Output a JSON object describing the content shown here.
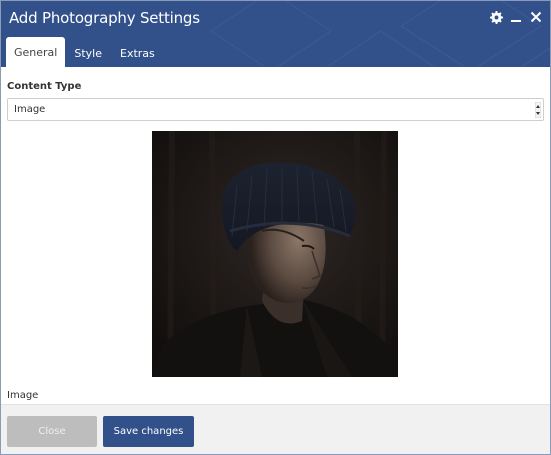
{
  "dialog": {
    "title": "Add Photography Settings",
    "window_icons": [
      "gear-icon",
      "minimize-icon",
      "close-icon"
    ]
  },
  "tabs": [
    {
      "label": "General",
      "active": true
    },
    {
      "label": "Style",
      "active": false
    },
    {
      "label": "Extras",
      "active": false
    }
  ],
  "content_type": {
    "label": "Content Type",
    "selected": "Image"
  },
  "image_field": {
    "label": "Image"
  },
  "footer": {
    "close_label": "Close",
    "save_label": "Save changes"
  },
  "colors": {
    "header": "#32508a",
    "save_button": "#32508a",
    "close_button": "#bdbdbd",
    "footer_bg": "#f1f1f1"
  }
}
